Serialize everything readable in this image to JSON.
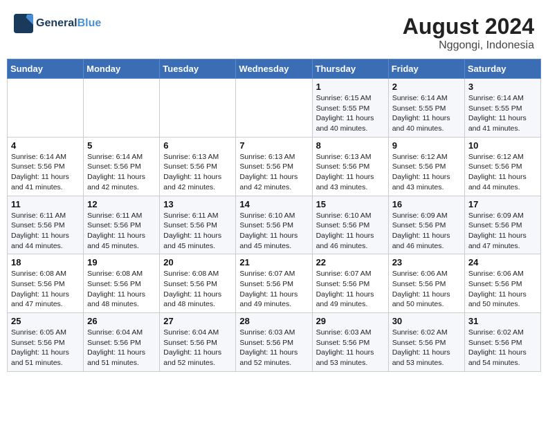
{
  "header": {
    "logo_line1": "General",
    "logo_line2": "Blue",
    "month_year": "August 2024",
    "location": "Nggongi, Indonesia"
  },
  "weekdays": [
    "Sunday",
    "Monday",
    "Tuesday",
    "Wednesday",
    "Thursday",
    "Friday",
    "Saturday"
  ],
  "weeks": [
    [
      {
        "day": "",
        "info": ""
      },
      {
        "day": "",
        "info": ""
      },
      {
        "day": "",
        "info": ""
      },
      {
        "day": "",
        "info": ""
      },
      {
        "day": "1",
        "info": "Sunrise: 6:15 AM\nSunset: 5:55 PM\nDaylight: 11 hours\nand 40 minutes."
      },
      {
        "day": "2",
        "info": "Sunrise: 6:14 AM\nSunset: 5:55 PM\nDaylight: 11 hours\nand 40 minutes."
      },
      {
        "day": "3",
        "info": "Sunrise: 6:14 AM\nSunset: 5:55 PM\nDaylight: 11 hours\nand 41 minutes."
      }
    ],
    [
      {
        "day": "4",
        "info": "Sunrise: 6:14 AM\nSunset: 5:56 PM\nDaylight: 11 hours\nand 41 minutes."
      },
      {
        "day": "5",
        "info": "Sunrise: 6:14 AM\nSunset: 5:56 PM\nDaylight: 11 hours\nand 42 minutes."
      },
      {
        "day": "6",
        "info": "Sunrise: 6:13 AM\nSunset: 5:56 PM\nDaylight: 11 hours\nand 42 minutes."
      },
      {
        "day": "7",
        "info": "Sunrise: 6:13 AM\nSunset: 5:56 PM\nDaylight: 11 hours\nand 42 minutes."
      },
      {
        "day": "8",
        "info": "Sunrise: 6:13 AM\nSunset: 5:56 PM\nDaylight: 11 hours\nand 43 minutes."
      },
      {
        "day": "9",
        "info": "Sunrise: 6:12 AM\nSunset: 5:56 PM\nDaylight: 11 hours\nand 43 minutes."
      },
      {
        "day": "10",
        "info": "Sunrise: 6:12 AM\nSunset: 5:56 PM\nDaylight: 11 hours\nand 44 minutes."
      }
    ],
    [
      {
        "day": "11",
        "info": "Sunrise: 6:11 AM\nSunset: 5:56 PM\nDaylight: 11 hours\nand 44 minutes."
      },
      {
        "day": "12",
        "info": "Sunrise: 6:11 AM\nSunset: 5:56 PM\nDaylight: 11 hours\nand 45 minutes."
      },
      {
        "day": "13",
        "info": "Sunrise: 6:11 AM\nSunset: 5:56 PM\nDaylight: 11 hours\nand 45 minutes."
      },
      {
        "day": "14",
        "info": "Sunrise: 6:10 AM\nSunset: 5:56 PM\nDaylight: 11 hours\nand 45 minutes."
      },
      {
        "day": "15",
        "info": "Sunrise: 6:10 AM\nSunset: 5:56 PM\nDaylight: 11 hours\nand 46 minutes."
      },
      {
        "day": "16",
        "info": "Sunrise: 6:09 AM\nSunset: 5:56 PM\nDaylight: 11 hours\nand 46 minutes."
      },
      {
        "day": "17",
        "info": "Sunrise: 6:09 AM\nSunset: 5:56 PM\nDaylight: 11 hours\nand 47 minutes."
      }
    ],
    [
      {
        "day": "18",
        "info": "Sunrise: 6:08 AM\nSunset: 5:56 PM\nDaylight: 11 hours\nand 47 minutes."
      },
      {
        "day": "19",
        "info": "Sunrise: 6:08 AM\nSunset: 5:56 PM\nDaylight: 11 hours\nand 48 minutes."
      },
      {
        "day": "20",
        "info": "Sunrise: 6:08 AM\nSunset: 5:56 PM\nDaylight: 11 hours\nand 48 minutes."
      },
      {
        "day": "21",
        "info": "Sunrise: 6:07 AM\nSunset: 5:56 PM\nDaylight: 11 hours\nand 49 minutes."
      },
      {
        "day": "22",
        "info": "Sunrise: 6:07 AM\nSunset: 5:56 PM\nDaylight: 11 hours\nand 49 minutes."
      },
      {
        "day": "23",
        "info": "Sunrise: 6:06 AM\nSunset: 5:56 PM\nDaylight: 11 hours\nand 50 minutes."
      },
      {
        "day": "24",
        "info": "Sunrise: 6:06 AM\nSunset: 5:56 PM\nDaylight: 11 hours\nand 50 minutes."
      }
    ],
    [
      {
        "day": "25",
        "info": "Sunrise: 6:05 AM\nSunset: 5:56 PM\nDaylight: 11 hours\nand 51 minutes."
      },
      {
        "day": "26",
        "info": "Sunrise: 6:04 AM\nSunset: 5:56 PM\nDaylight: 11 hours\nand 51 minutes."
      },
      {
        "day": "27",
        "info": "Sunrise: 6:04 AM\nSunset: 5:56 PM\nDaylight: 11 hours\nand 52 minutes."
      },
      {
        "day": "28",
        "info": "Sunrise: 6:03 AM\nSunset: 5:56 PM\nDaylight: 11 hours\nand 52 minutes."
      },
      {
        "day": "29",
        "info": "Sunrise: 6:03 AM\nSunset: 5:56 PM\nDaylight: 11 hours\nand 53 minutes."
      },
      {
        "day": "30",
        "info": "Sunrise: 6:02 AM\nSunset: 5:56 PM\nDaylight: 11 hours\nand 53 minutes."
      },
      {
        "day": "31",
        "info": "Sunrise: 6:02 AM\nSunset: 5:56 PM\nDaylight: 11 hours\nand 54 minutes."
      }
    ]
  ]
}
